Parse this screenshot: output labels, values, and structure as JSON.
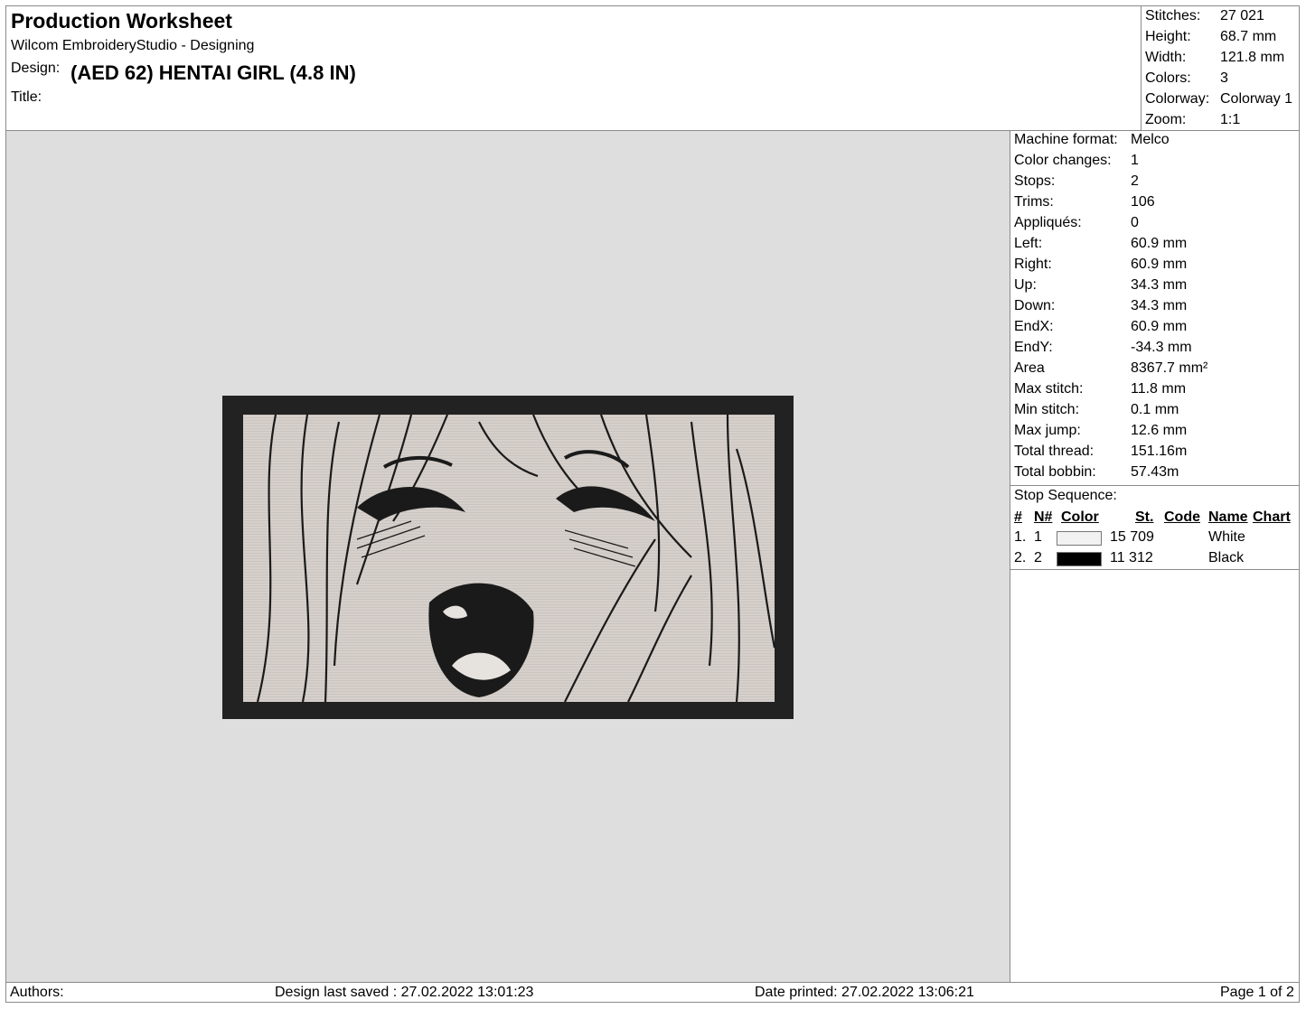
{
  "header": {
    "title": "Production Worksheet",
    "app": "Wilcom EmbroideryStudio - Designing",
    "design_label": "Design:",
    "design_value": "(AED 62) HENTAI GIRL (4.8 IN)",
    "title_label": "Title:"
  },
  "summary": [
    {
      "label": "Stitches:",
      "value": "27 021"
    },
    {
      "label": "Height:",
      "value": "68.7 mm"
    },
    {
      "label": "Width:",
      "value": "121.8 mm"
    },
    {
      "label": "Colors:",
      "value": "3"
    },
    {
      "label": "Colorway:",
      "value": "Colorway 1"
    },
    {
      "label": "Zoom:",
      "value": "1:1"
    }
  ],
  "details": [
    {
      "label": "Machine format:",
      "value": "Melco"
    },
    {
      "label": "Color changes:",
      "value": "1"
    },
    {
      "label": "Stops:",
      "value": "2"
    },
    {
      "label": "Trims:",
      "value": "106"
    },
    {
      "label": "Appliqués:",
      "value": "0"
    },
    {
      "label": "Left:",
      "value": "60.9 mm"
    },
    {
      "label": "Right:",
      "value": "60.9 mm"
    },
    {
      "label": "Up:",
      "value": "34.3 mm"
    },
    {
      "label": "Down:",
      "value": "34.3 mm"
    },
    {
      "label": "EndX:",
      "value": "60.9 mm"
    },
    {
      "label": "EndY:",
      "value": "-34.3 mm"
    },
    {
      "label": "Area",
      "value": "8367.7 mm²"
    },
    {
      "label": "Max stitch:",
      "value": "11.8 mm"
    },
    {
      "label": "Min stitch:",
      "value": "0.1 mm"
    },
    {
      "label": "Max jump:",
      "value": "12.6 mm"
    },
    {
      "label": "Total thread:",
      "value": "151.16m"
    },
    {
      "label": "Total bobbin:",
      "value": "57.43m"
    }
  ],
  "stop_sequence": {
    "title": "Stop Sequence:",
    "columns": [
      "#",
      "N#",
      "Color",
      "St.",
      "Code",
      "Name",
      "Chart"
    ],
    "rows": [
      {
        "index": "1.",
        "n": "1",
        "color": "#f2f2f2",
        "stitches": "15 709",
        "code": "",
        "name": "White",
        "chart": ""
      },
      {
        "index": "2.",
        "n": "2",
        "color": "#000000",
        "stitches": "11 312",
        "code": "",
        "name": "Black",
        "chart": ""
      }
    ]
  },
  "footer": {
    "authors": "Authors:",
    "saved": "Design last saved : 27.02.2022 13:01:23",
    "printed": "Date printed: 27.02.2022 13:06:21",
    "page": "Page 1 of 2"
  },
  "colors": {
    "canvas_bg": "#dedede",
    "design_fill": "#d6d0cc",
    "border_stitch": "#222222"
  }
}
